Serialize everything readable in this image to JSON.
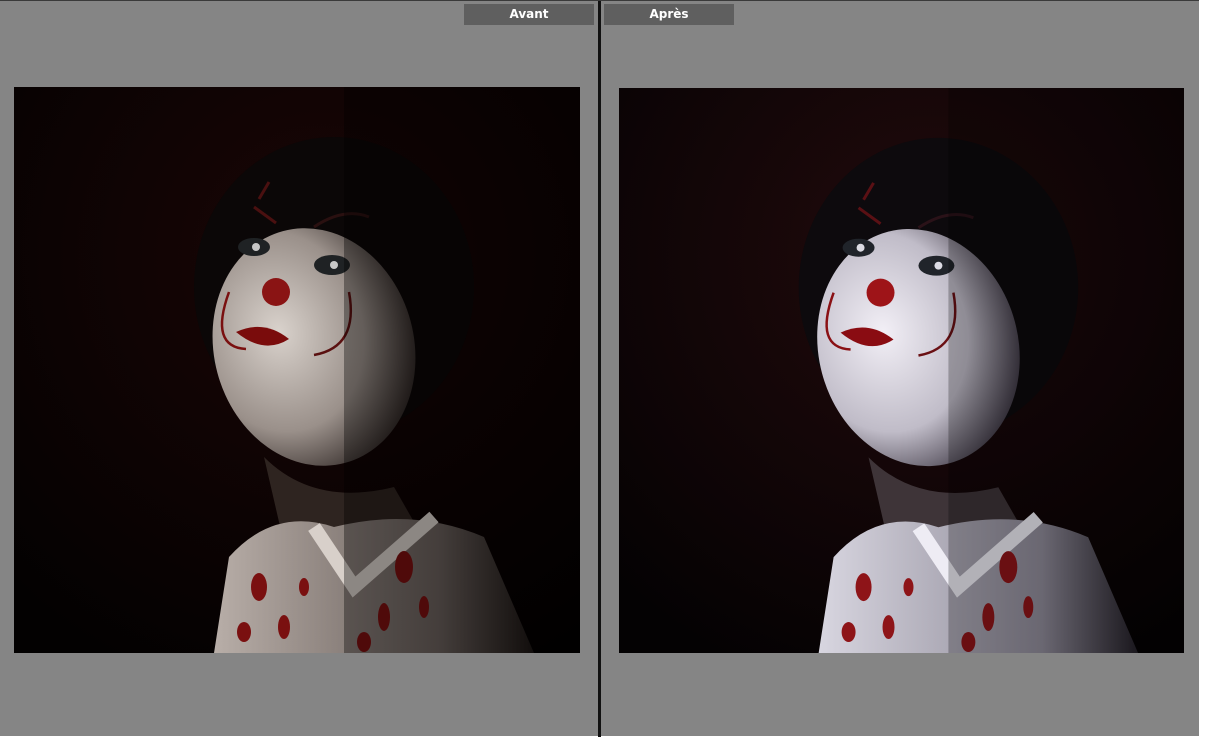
{
  "compare_view": {
    "before": {
      "label": "Avant"
    },
    "after": {
      "label": "Après"
    }
  },
  "colors": {
    "workspace_bg": "#858585",
    "label_bg": "#5f5f5f",
    "divider": "#111111"
  }
}
